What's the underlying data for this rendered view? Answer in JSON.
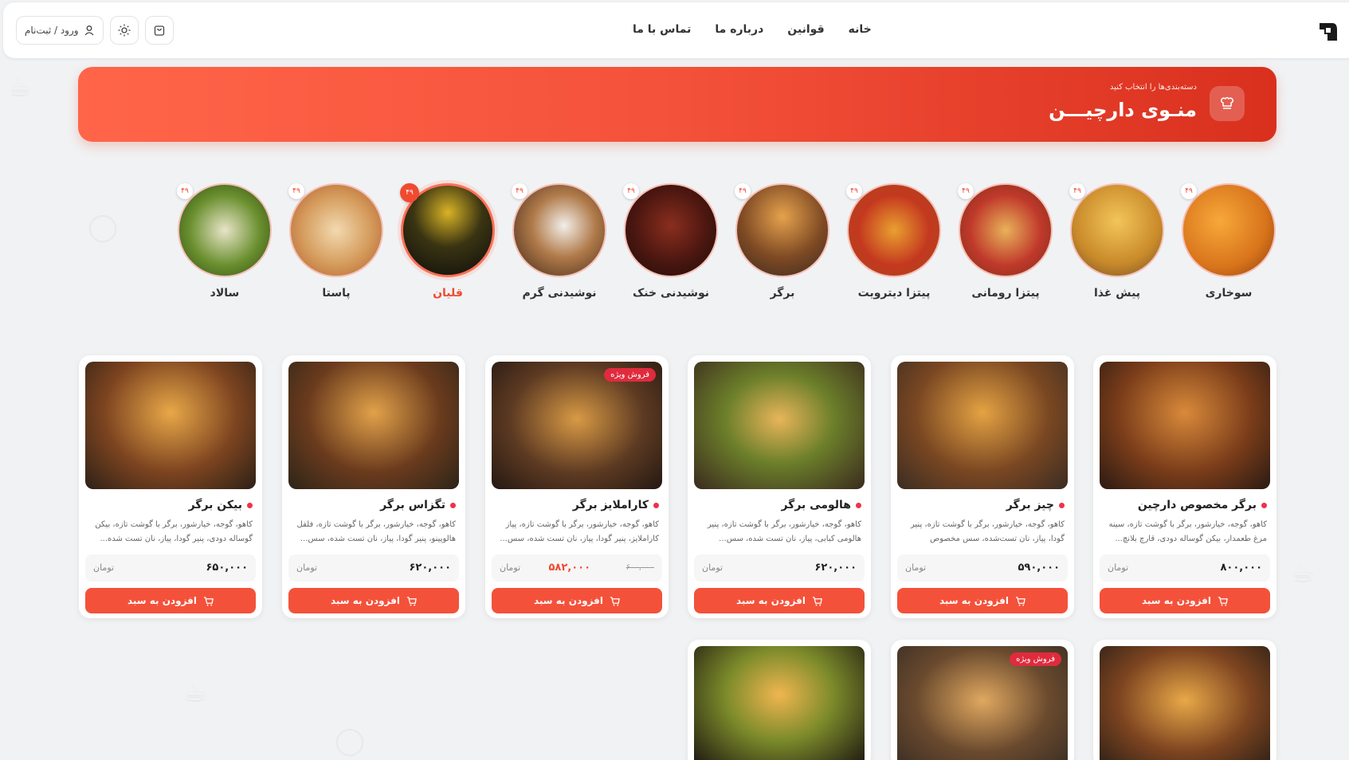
{
  "header": {
    "nav": [
      "خانه",
      "قوانین",
      "درباره ما",
      "تماس با ما"
    ],
    "login_label": "ورود / ثبت‌نام"
  },
  "banner": {
    "subtitle": "دسته‌بندی‌ها را انتخاب کنید",
    "title": "منـوی دارچیـــن"
  },
  "categories": [
    {
      "label": "سوخاری",
      "badge": "۴۹"
    },
    {
      "label": "پیش غذا",
      "badge": "۴۹"
    },
    {
      "label": "پیتزا رومانی",
      "badge": "۴۹"
    },
    {
      "label": "پیتزا دیترویت",
      "badge": "۴۹"
    },
    {
      "label": "برگر",
      "badge": "۴۹"
    },
    {
      "label": "نوشیدنی خنک",
      "badge": "۴۹"
    },
    {
      "label": "نوشیدنی گرم",
      "badge": "۴۹"
    },
    {
      "label": "قلیان",
      "badge": "۴۹"
    },
    {
      "label": "پاستا",
      "badge": "۴۹"
    },
    {
      "label": "سالاد",
      "badge": "۴۹"
    }
  ],
  "products": [
    {
      "name": "برگر مخصوص دارچین",
      "desc": "کاهو، گوجه، خیارشور، برگر با گوشت تازه، سینه مرغ طعمدار، بیکن گوساله دودی، قارچ بلانچ...",
      "price": "۸۰۰,۰۰۰",
      "unit": "تومان",
      "add": "افزودن به سبد"
    },
    {
      "name": "چیز برگر",
      "desc": "کاهو، گوجه، خیارشور، برگر با گوشت تازه، پنیر گودا، پیاز، نان تست‌شده، سس مخصوص",
      "price": "۵۹۰,۰۰۰",
      "unit": "تومان",
      "add": "افزودن به سبد"
    },
    {
      "name": "هالومی برگر",
      "desc": "کاهو، گوجه، خیارشور، برگر با گوشت تازه، پنیر هالومی کبابی، پیاز، نان تست شده، سس...",
      "price": "۶۲۰,۰۰۰",
      "unit": "تومان",
      "add": "افزودن به سبد"
    },
    {
      "name": "کاراملایز برگر",
      "desc": "کاهو، گوجه، خیارشور، برگر با گوشت تازه، پیاز کاراملایز، پنیر گودا، پیاز، نان تست شده، سس...",
      "price": "۵۸۲,۰۰۰",
      "old_price": "۶۰۰,۰۰۰",
      "special": "فروش ویژه",
      "unit": "تومان",
      "add": "افزودن به سبد"
    },
    {
      "name": "تگزاس برگر",
      "desc": "کاهو، گوجه، خیارشور، برگر با گوشت تازه، فلفل هالوپینو، پنیر گودا، پیاز، نان تست شده، سس...",
      "price": "۶۲۰,۰۰۰",
      "unit": "تومان",
      "add": "افزودن به سبد"
    },
    {
      "name": "بیکن برگر",
      "desc": "کاهو، گوجه، خیارشور، برگر با گوشت تازه، بیکن گوساله دودی، پنیر گودا، پیاز، نان تست شده...",
      "price": "۶۵۰,۰۰۰",
      "unit": "تومان",
      "add": "افزودن به سبد"
    }
  ],
  "row2_special": "فروش ویژه",
  "colors": {
    "accent": "#f4513a",
    "banner_start": "#ff6549",
    "banner_end": "#d9301e",
    "dot": "#f0314a"
  }
}
